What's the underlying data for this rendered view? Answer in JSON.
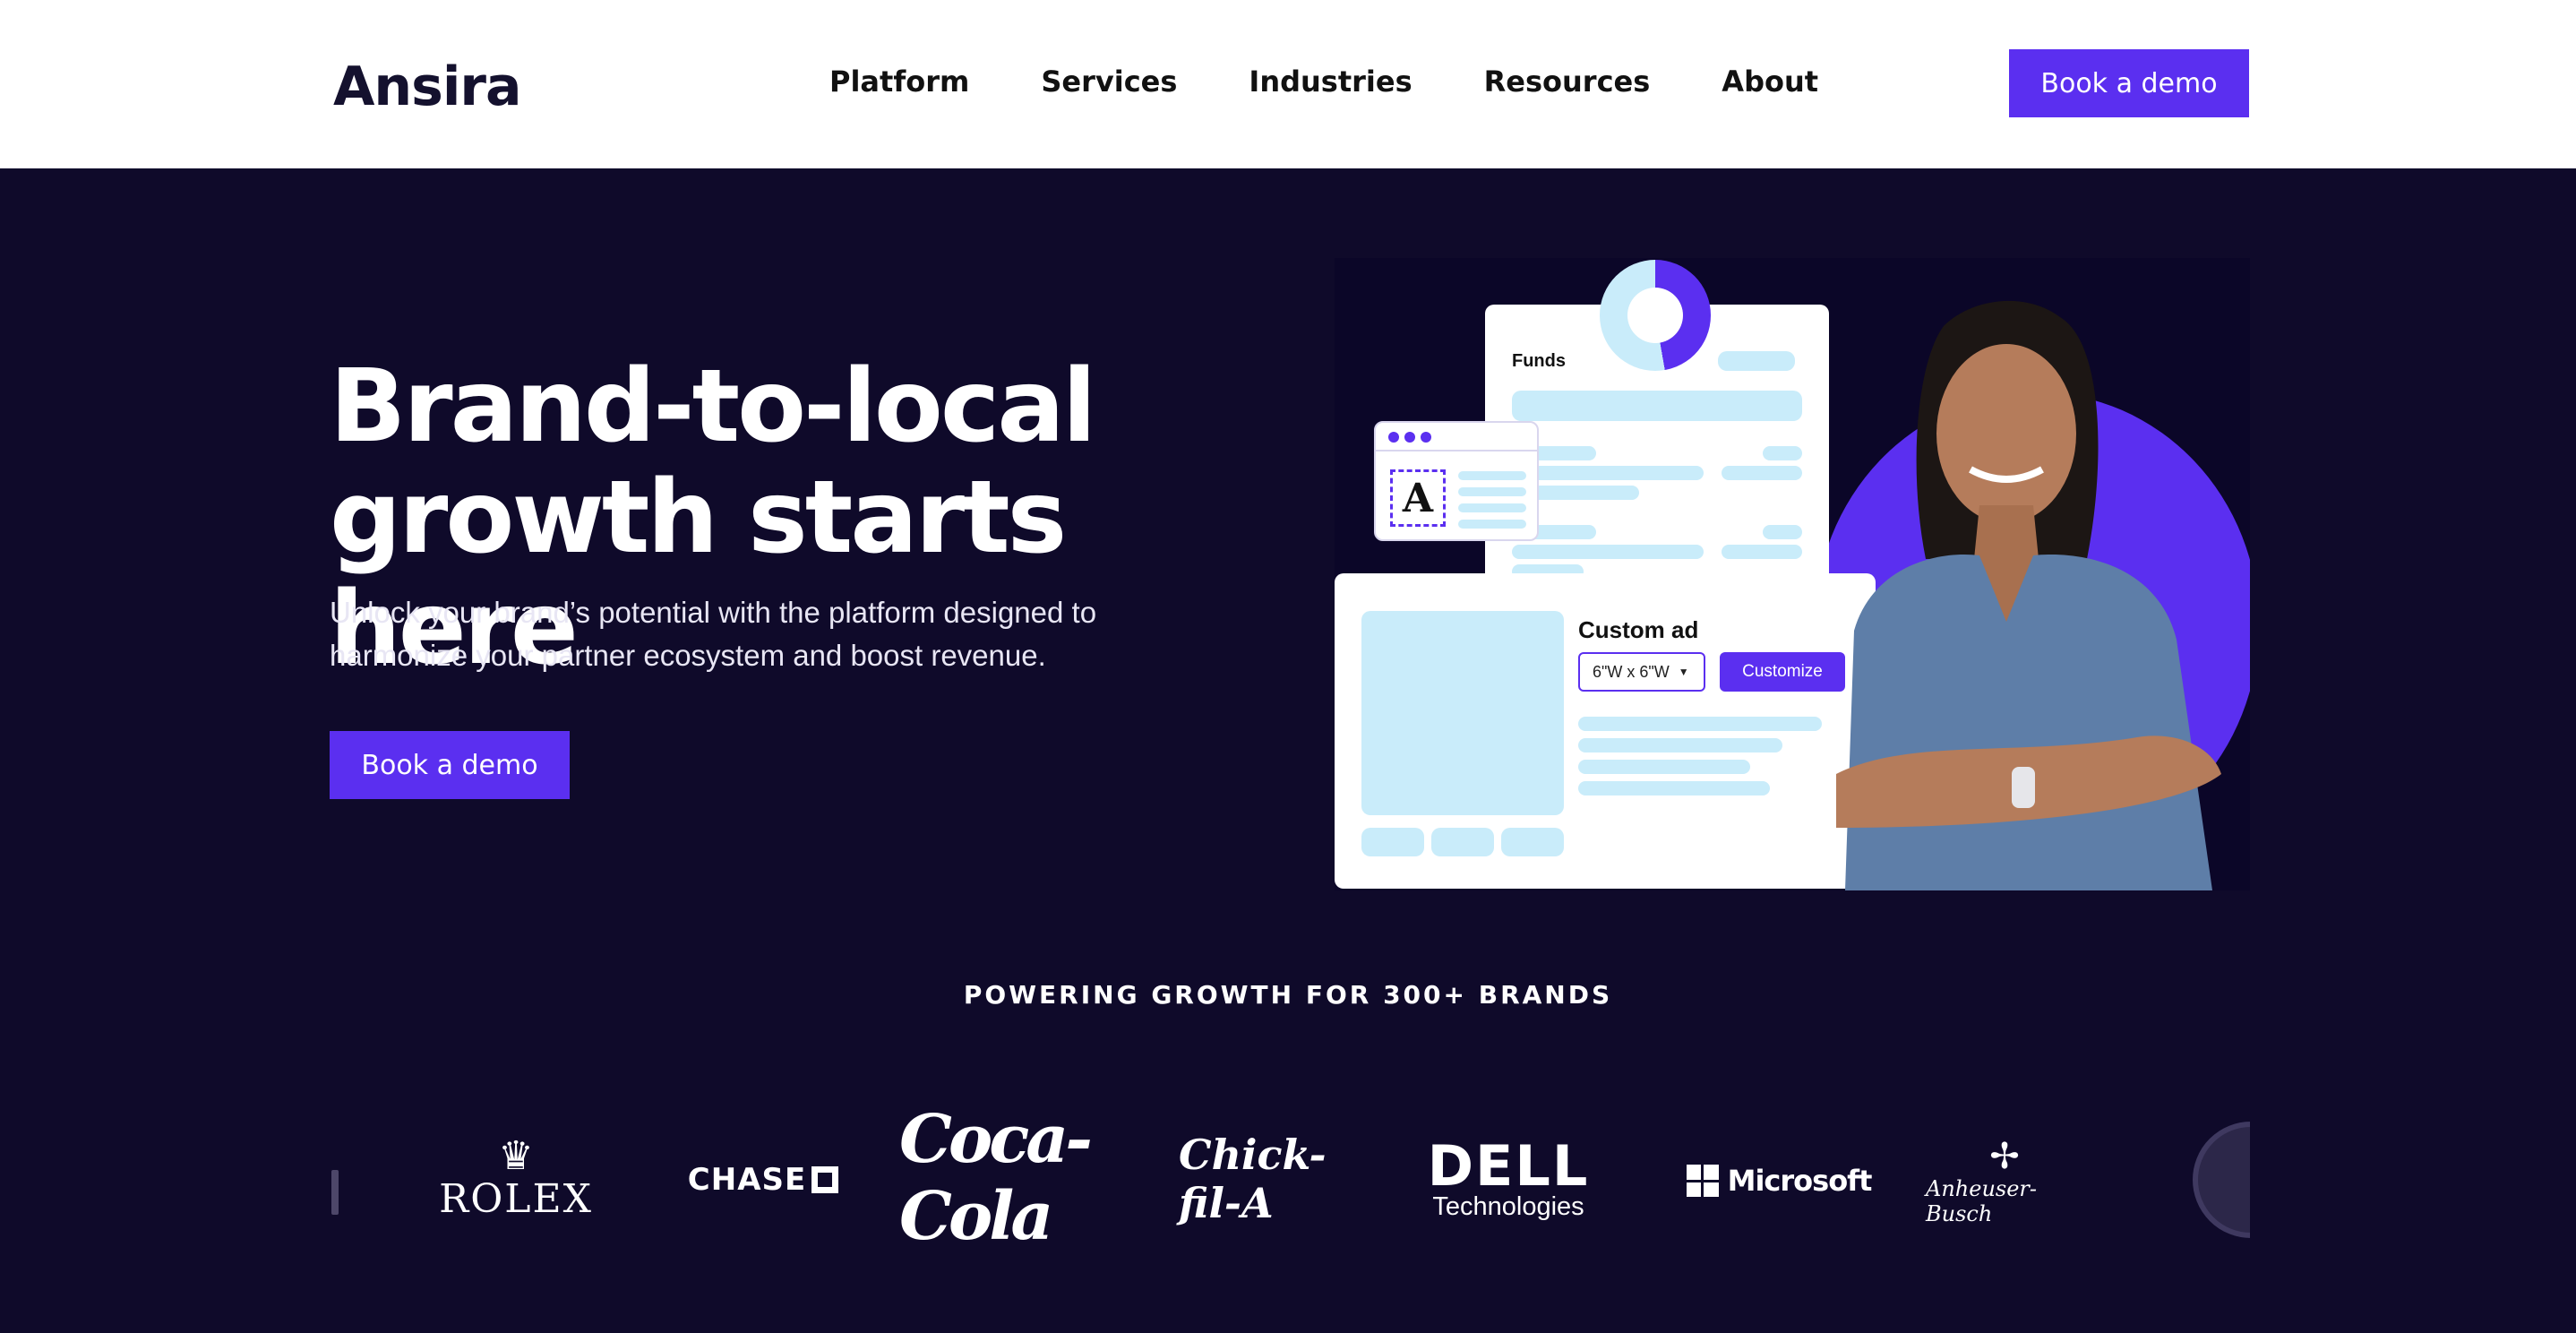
{
  "header": {
    "logo": "Ansira",
    "nav": [
      "Platform",
      "Services",
      "Industries",
      "Resources",
      "About"
    ],
    "cta": "Book a demo"
  },
  "hero": {
    "title_line1": "Brand-to-local",
    "title_line2": "growth starts here",
    "subtitle_line1": "Unlock your brand’s potential with the platform designed to",
    "subtitle_line2": "harmonize your partner ecosystem and boost revenue.",
    "cta": "Book a demo"
  },
  "illustration": {
    "funds_label": "Funds",
    "font_letter": "A",
    "ad_title": "Custom ad",
    "ad_size": "6\"W x 6\"W",
    "ad_button": "Customize"
  },
  "brands": {
    "heading": "POWERING GROWTH FOR 300+ BRANDS",
    "logos": {
      "rolex": "ROLEX",
      "chase": "CHASE",
      "coca_cola": "Coca-Cola",
      "chick_fil_a": "Chick-fil-A",
      "dell": "DELL",
      "dell_sub": "Technologies",
      "microsoft": "Microsoft",
      "anheuser_busch": "Anheuser-Busch"
    }
  },
  "colors": {
    "brand_purple": "#5b2ff0",
    "hero_bg": "#0f0a2a",
    "light_blue": "#c9ecfa"
  }
}
